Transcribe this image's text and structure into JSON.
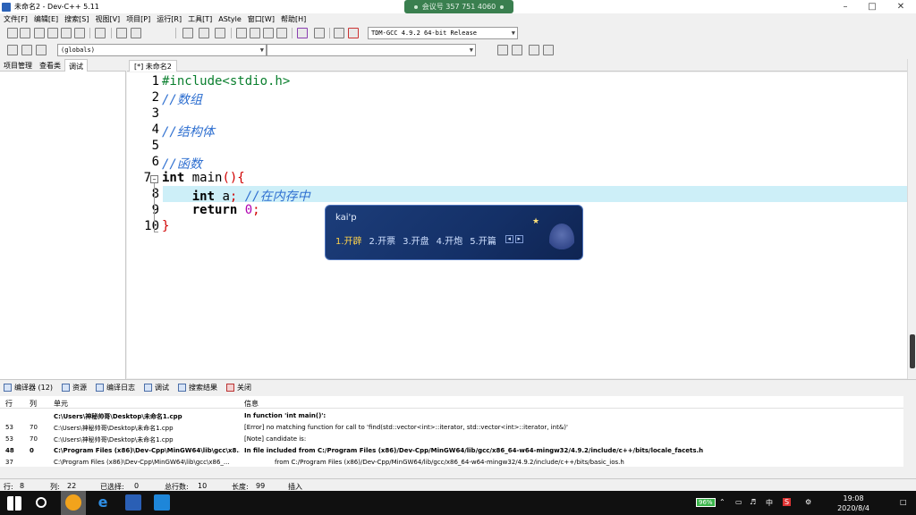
{
  "window": {
    "title": "未命名2 - Dev-C++ 5.11",
    "meeting_banner": "会议号 357 751 4060"
  },
  "menu": [
    "文件[F]",
    "编辑[E]",
    "搜索[S]",
    "视图[V]",
    "项目[P]",
    "运行[R]",
    "工具[T]",
    "AStyle",
    "窗口[W]",
    "帮助[H]"
  ],
  "toolbar": {
    "compiler": "TDM-GCC 4.9.2 64-bit Release",
    "scope": "(globals)"
  },
  "left_panel": {
    "tabs": [
      "项目管理",
      "查看类",
      "调试"
    ]
  },
  "editor": {
    "tab_label": "[*] 未命名2",
    "line_numbers": [
      "1",
      "2",
      "3",
      "4",
      "5",
      "6",
      "7",
      "8",
      "9",
      "10"
    ],
    "lines": {
      "l1": "#include<stdio.h>",
      "l2": "//数组",
      "l4": "//结构体",
      "l6": "//函数",
      "l7_kw": "int",
      "l7_name": " main",
      "l7_paren": "(){",
      "l8_indent": "    ",
      "l8_kw": "int",
      "l8_var": " a",
      "l8_semi": ";",
      "l8_cmt": " //在内存中",
      "l9_indent": "    ",
      "l9_kw": "return",
      "l9_num": " 0",
      "l9_semi": ";",
      "l10": "}"
    }
  },
  "ime": {
    "input": "kai'p",
    "candidates": [
      "1.开辟",
      "2.开票",
      "3.开盘",
      "4.开炮",
      "5.开篇"
    ]
  },
  "bottom_tabs": [
    "编译器 (12)",
    "资源",
    "编译日志",
    "调试",
    "搜索结果",
    "关闭"
  ],
  "messages": {
    "headers": {
      "row": "行",
      "col": "列",
      "unit": "单元",
      "info": "信息"
    },
    "rows": [
      {
        "row": "",
        "col": "",
        "unit": "C:\\Users\\神秘帅哥\\Desktop\\未命名1.cpp",
        "info": "In function 'int main()':",
        "bold": true
      },
      {
        "row": "53",
        "col": "70",
        "unit": "C:\\Users\\神秘帅哥\\Desktop\\未命名1.cpp",
        "info": "[Error] no matching function for call to 'find(std::vector<int>::iterator, std::vector<int>::iterator, int&)'",
        "bold": false
      },
      {
        "row": "53",
        "col": "70",
        "unit": "C:\\Users\\神秘帅哥\\Desktop\\未命名1.cpp",
        "info": "[Note] candidate is:",
        "bold": false
      },
      {
        "row": "48",
        "col": "0",
        "unit": "C:\\Program Files (x86)\\Dev-Cpp\\MinGW64\\lib\\gcc\\x8...",
        "info": "In file included from C:/Program Files (x86)/Dev-Cpp/MinGW64/lib/gcc/x86_64-w64-mingw32/4.9.2/include/c++/bits/locale_facets.h",
        "bold": true
      },
      {
        "row": "37",
        "col": "",
        "unit": "C:\\Program Files (x86)\\Dev-Cpp\\MinGW64\\lib\\gcc\\x86_...",
        "info": "from C:/Program Files (x86)/Dev-Cpp/MinGW64/lib/gcc/x86_64-w64-mingw32/4.9.2/include/c++/bits/basic_ios.h",
        "bold": false
      }
    ]
  },
  "status": {
    "line_label": "行:",
    "line": "8",
    "col_label": "列:",
    "col": "22",
    "sel_label": "已选择:",
    "sel": "0",
    "total_label": "总行数:",
    "total": "10",
    "len_label": "长度:",
    "len": "99",
    "mode": "插入"
  },
  "taskbar": {
    "battery": "96%",
    "ime_lang": "中",
    "time": "19:08",
    "date": "2020/8/4"
  }
}
